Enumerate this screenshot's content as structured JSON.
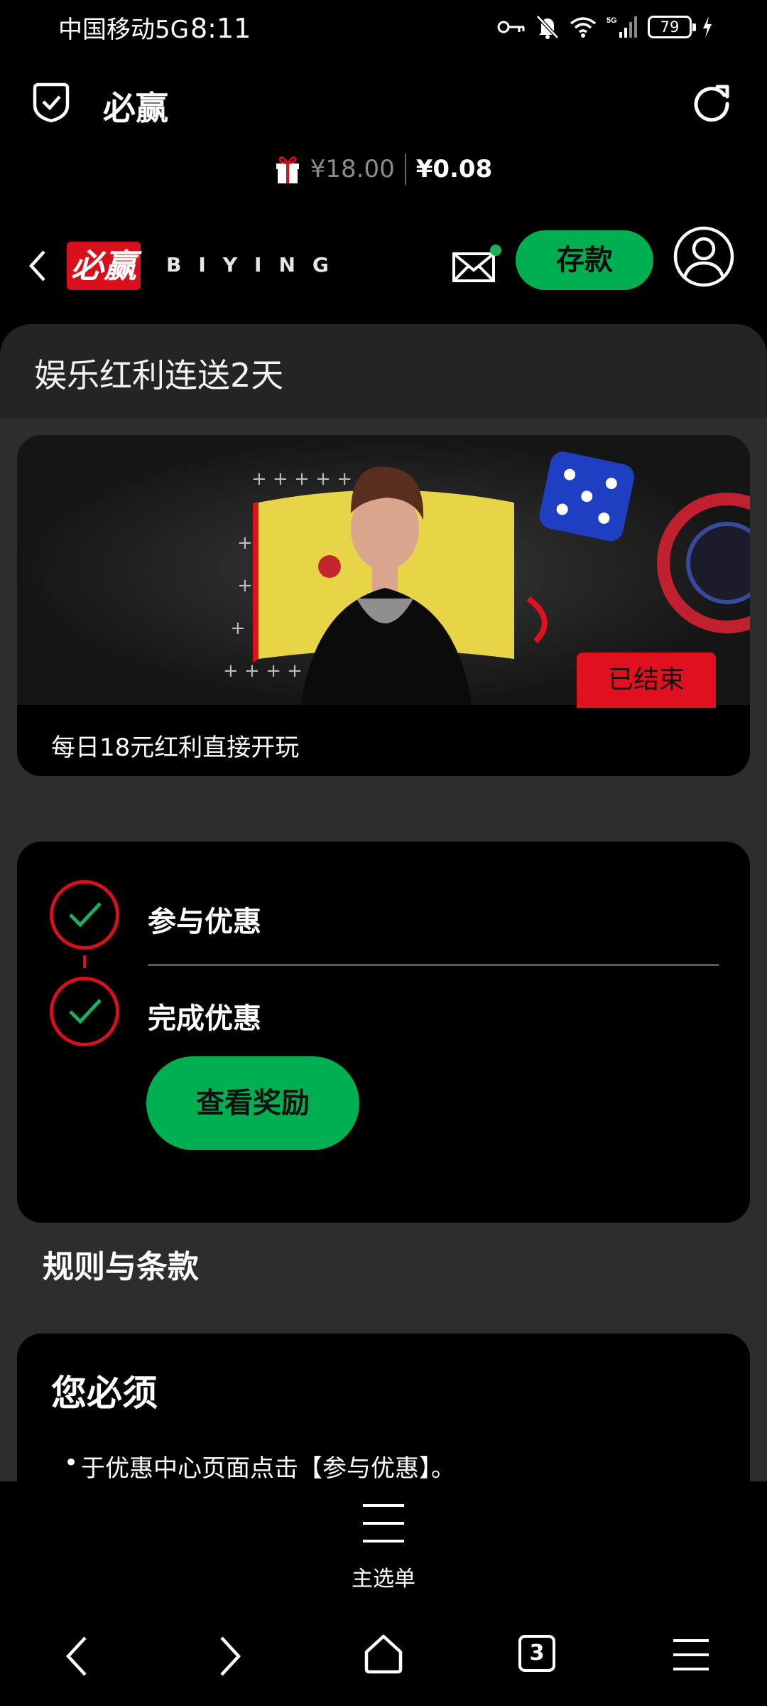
{
  "status_bar": {
    "carrier": "中国移动5G",
    "time": "8:11",
    "battery": "79"
  },
  "browser": {
    "title": "必赢"
  },
  "balance": {
    "bonus": "¥18.00",
    "main": "¥0.08"
  },
  "site_nav": {
    "logo_mark": "必赢",
    "logo_text": "BIYING",
    "deposit_label": "存款"
  },
  "page": {
    "title": "娱乐红利连送2天"
  },
  "promo": {
    "status": "已结束",
    "description": "每日18元红利直接开玩"
  },
  "steps": {
    "items": [
      {
        "label": "参与优惠"
      },
      {
        "label": "完成优惠"
      }
    ],
    "reward_button": "查看奖励"
  },
  "rules": {
    "title": "规则与条款",
    "must_title": "您必须",
    "items": [
      "于优惠中心页面点击【参与优惠】。"
    ]
  },
  "bottom_menu": {
    "label": "主选单"
  },
  "system_nav": {
    "tab_count": "3"
  },
  "colors": {
    "accent_green": "#00b050",
    "accent_red": "#d7101b",
    "panel_bg": "#2d2d2d",
    "card_bg": "#000000"
  }
}
